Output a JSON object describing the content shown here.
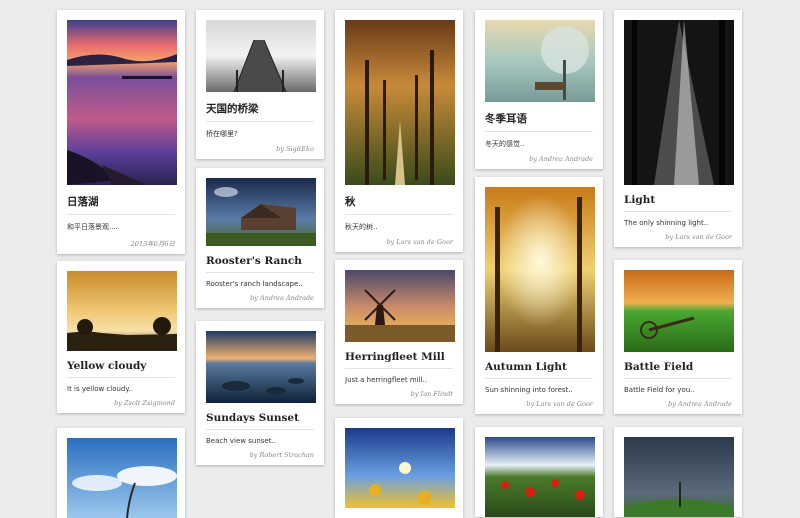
{
  "cards": [
    {
      "title": "日落湖",
      "desc": "和平日落景观....",
      "author": "2013年6月6日"
    },
    {
      "title": "天国的桥梁",
      "desc": "桥在哪里?",
      "author": "by SigitEko"
    },
    {
      "title": "秋",
      "desc": "秋天的树..",
      "author": "by Lars van de Goor"
    },
    {
      "title": "冬季耳语",
      "desc": "冬天的感觉..",
      "author": "by Andrea Andrade"
    },
    {
      "title": "Light",
      "desc": "The only shinning light..",
      "author": "by Lars van de Goor"
    },
    {
      "title": "Rooster's Ranch",
      "desc": "Rooster's ranch landscape..",
      "author": "by Andrea Andrade"
    },
    {
      "title": "Yellow cloudy",
      "desc": "It is yellow cloudy..",
      "author": "by Zsolt Zsigmond"
    },
    {
      "title": "Herringfleet Mill",
      "desc": "Just a herringfleet mill..",
      "author": "by Ian Flindt"
    },
    {
      "title": "Autumn Light",
      "desc": "Sun shinning into forest..",
      "author": "by Lars van de Goor"
    },
    {
      "title": "Battle Field",
      "desc": "Battle Field for you..",
      "author": "by Andrea Andrade"
    },
    {
      "title": "Sundays Sunset",
      "desc": "Beach view sunset..",
      "author": "by Robert Strachan"
    }
  ]
}
